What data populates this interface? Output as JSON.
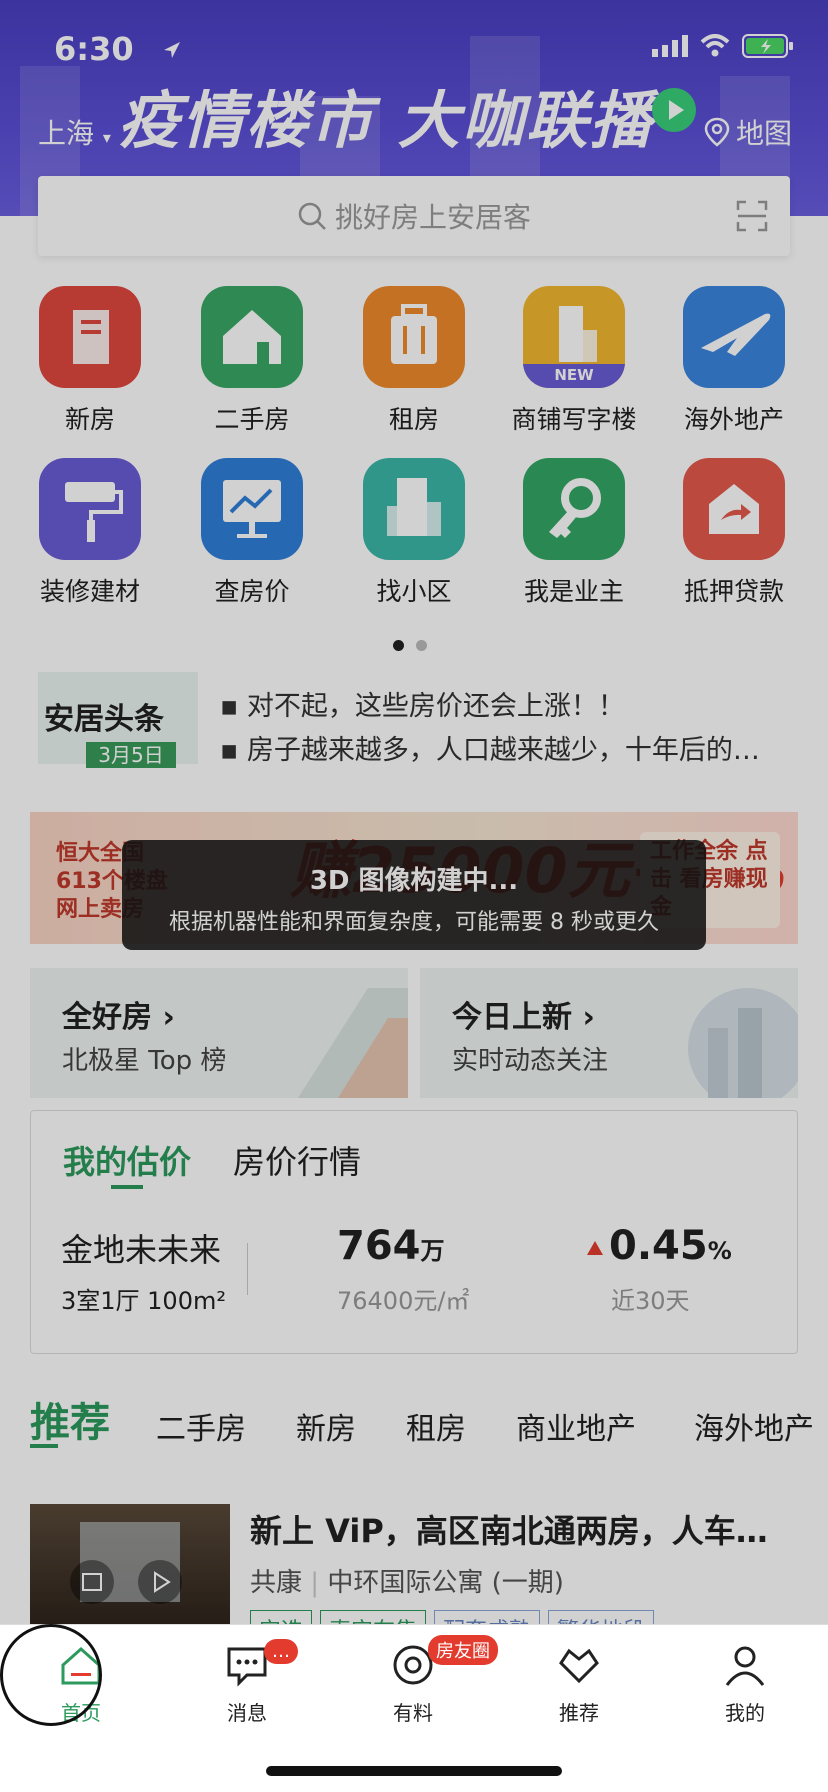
{
  "status": {
    "time": "6:30"
  },
  "header": {
    "city": "上海",
    "headline": "疫情楼市 大咖联播",
    "map_label": "地图"
  },
  "search": {
    "placeholder": "挑好房上安居客"
  },
  "grid": [
    {
      "label": "新房",
      "color": "#e0483f",
      "icon": "building-icon"
    },
    {
      "label": "二手房",
      "color": "#3aa866",
      "icon": "house-icon"
    },
    {
      "label": "租房",
      "color": "#ef8a2c",
      "icon": "suitcase-icon"
    },
    {
      "label": "商铺写字楼",
      "color": "#f2b930",
      "icon": "office-icon",
      "badge": "NEW"
    },
    {
      "label": "海外地产",
      "color": "#3a86e0",
      "icon": "airplane-icon"
    },
    {
      "label": "装修建材",
      "color": "#6a5cd6",
      "icon": "paint-roller-icon"
    },
    {
      "label": "查房价",
      "color": "#2f7fd8",
      "icon": "chart-icon"
    },
    {
      "label": "找小区",
      "color": "#3ab8a8",
      "icon": "community-icon"
    },
    {
      "label": "我是业主",
      "color": "#34a866",
      "icon": "key-icon"
    },
    {
      "label": "抵押贷款",
      "color": "#e55a4c",
      "icon": "mortgage-icon"
    }
  ],
  "news": {
    "logo": "安居头条",
    "date": "3月5日",
    "lines": [
      "对不起，这些房价还会上涨！！",
      "房子越来越多，人口越来越少，十年后的…"
    ]
  },
  "ad": {
    "left": "恒大全国 613个楼盘 网上卖房",
    "big": "赚25000元+1%",
    "right": "工作全余 点击 看房赚现金"
  },
  "toast": {
    "title": "3D 图像构建中...",
    "message": "根据机器性能和界面复杂度，可能需要 8 秒或更久"
  },
  "cards": [
    {
      "title": "全好房",
      "subtitle": "北极星 Top 榜"
    },
    {
      "title": "今日上新",
      "subtitle": "实时动态关注"
    }
  ],
  "estimate": {
    "tab_active": "我的估价",
    "tab_other": "房价行情",
    "property": "金地未未来",
    "layout": "3室1厅 100m²",
    "price": "764",
    "price_unit": "万",
    "unit_price": "76400元/㎡",
    "change": "0.45",
    "change_unit": "%",
    "period": "近30天"
  },
  "rec_tabs": [
    "推荐",
    "二手房",
    "新房",
    "租房",
    "商业地产",
    "海外地产"
  ],
  "listing": {
    "title": "新上 ViP，高区南北通两房，人车…",
    "area": "共康",
    "estate": "中环国际公寓 (一期)",
    "tags": [
      "安选",
      "真实在售",
      "配套成熟",
      "繁华地段"
    ]
  },
  "tabbar": [
    {
      "label": "首页",
      "icon": "home-icon"
    },
    {
      "label": "消息",
      "icon": "message-icon",
      "badge": "…"
    },
    {
      "label": "有料",
      "icon": "target-icon",
      "badge": "房友圈"
    },
    {
      "label": "推荐",
      "icon": "heart-icon"
    },
    {
      "label": "我的",
      "icon": "user-icon"
    }
  ]
}
